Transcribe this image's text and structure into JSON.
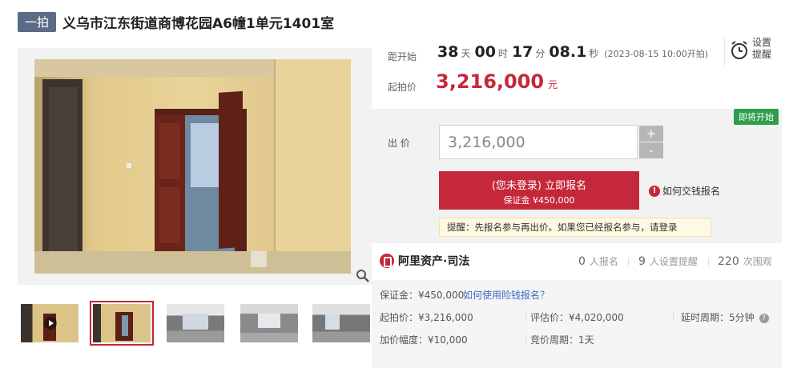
{
  "header": {
    "tag": "一拍",
    "title": "义乌市江东街道商博花园A6幢1单元1401室"
  },
  "countdown": {
    "label": "距开始",
    "days": "38",
    "days_unit": "天",
    "hours": "00",
    "hours_unit": "时",
    "minutes": "17",
    "minutes_unit": "分",
    "seconds": "08.1",
    "seconds_unit": "秒",
    "start_time": "(2023-08-15 10:00开拍)"
  },
  "reminder": {
    "label": "设置 提醒",
    "icon": "alarm-clock-icon"
  },
  "starting_price": {
    "label": "起拍价",
    "value": "3,216,000",
    "unit": "元"
  },
  "bid": {
    "badge": "即将开始",
    "label": "出 价",
    "input_value": "3,216,000",
    "plus": "+",
    "minus": "-",
    "signup_line1": "(您未登录) 立即报名",
    "signup_line2": "保证金 ¥450,000",
    "howto": "如何交钱报名",
    "notice": "提醒：先报名参与再出价。如果您已经报名参与，请登录"
  },
  "platform": {
    "name": "阿里资产·司法"
  },
  "stats": [
    {
      "num": "0",
      "label": "人报名"
    },
    {
      "num": "9",
      "label": "人设置提醒"
    },
    {
      "num": "220",
      "label": "次围观"
    }
  ],
  "details": {
    "deposit": "保证金：¥450,000",
    "deposit_link": "如何使用险钱报名？",
    "start": "起拍价：¥3,216,000",
    "appraisal": "评估价：¥4,020,000",
    "delay": "延时周期：5分钟",
    "increment": "加价幅度：¥10,000",
    "cycle": "竞价周期：1天"
  },
  "colors": {
    "accent": "#c4283a",
    "badge_green": "#2f9e48",
    "tag_bg": "#5b6b86"
  }
}
